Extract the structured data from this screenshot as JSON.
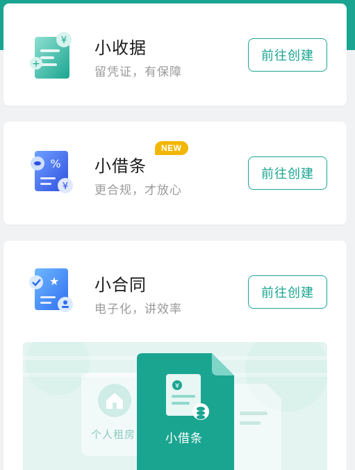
{
  "cards": [
    {
      "title": "小收据",
      "subtitle": "留凭证，有保障",
      "button": "前往创建",
      "icon": "receipt-icon"
    },
    {
      "title": "小借条",
      "subtitle": "更合规，才放心",
      "button": "前往创建",
      "icon": "iou-note-icon",
      "badge": "NEW"
    },
    {
      "title": "小合同",
      "subtitle": "电子化，讲效率",
      "button": "前往创建",
      "icon": "contract-icon"
    }
  ],
  "templates": {
    "items": [
      {
        "label": "个人租房",
        "icon": "home-icon",
        "selected": false
      },
      {
        "label": "小借条",
        "icon": "document-coin-icon",
        "selected": true
      }
    ]
  },
  "colors": {
    "accent": "#1aa591",
    "badge": "#f2b705",
    "blue": "#2f6ef0",
    "background": "#f1f2f4"
  }
}
